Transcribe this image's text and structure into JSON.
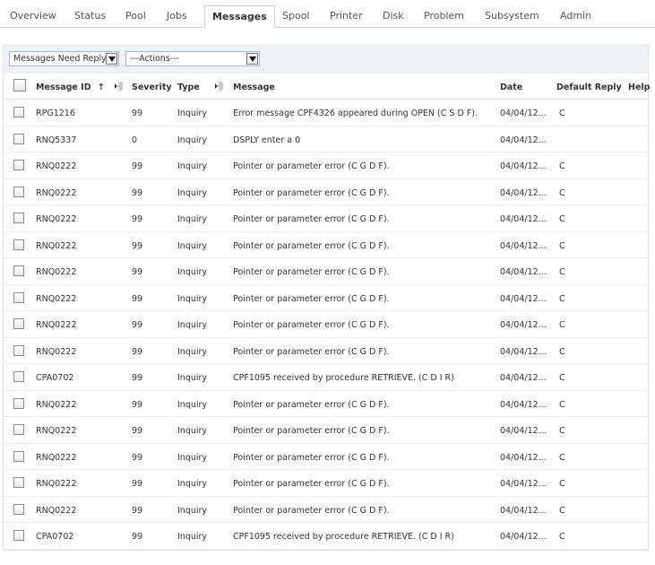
{
  "tabs": [
    {
      "label": "Overview",
      "active": false
    },
    {
      "label": "Status",
      "active": false
    },
    {
      "label": "Pool",
      "active": false
    },
    {
      "label": "Jobs",
      "active": false
    },
    {
      "label": "Messages",
      "active": true
    },
    {
      "label": "Spool",
      "active": false
    },
    {
      "label": "Printer",
      "active": false
    },
    {
      "label": "Disk",
      "active": false
    },
    {
      "label": "Problem",
      "active": false
    },
    {
      "label": "Subsystem",
      "active": false
    },
    {
      "label": "Admin",
      "active": false
    }
  ],
  "toolbar": {
    "filter_select": "Messages Need Reply",
    "actions_select": "---Actions---"
  },
  "columns": {
    "message_id": "Message ID",
    "sort_indicator": "↑",
    "severity": "Severity",
    "type": "Type",
    "message": "Message",
    "date": "Date",
    "default_reply": "Default Reply",
    "help": "Help"
  },
  "rows": [
    {
      "id": "RPG1216",
      "severity": "99",
      "type": "Inquiry",
      "message": "Error message CPF4326 appeared during OPEN (C S D F).",
      "date": "04/04/12...",
      "reply": "C"
    },
    {
      "id": "RNQ5337",
      "severity": "0",
      "type": "Inquiry",
      "message": "DSPLY enter a 0",
      "date": "04/04/12...",
      "reply": ""
    },
    {
      "id": "RNQ0222",
      "severity": "99",
      "type": "Inquiry",
      "message": "Pointer or parameter error (C G D F).",
      "date": "04/04/12...",
      "reply": "C"
    },
    {
      "id": "RNQ0222",
      "severity": "99",
      "type": "Inquiry",
      "message": "Pointer or parameter error (C G D F).",
      "date": "04/04/12...",
      "reply": "C"
    },
    {
      "id": "RNQ0222",
      "severity": "99",
      "type": "Inquiry",
      "message": "Pointer or parameter error (C G D F).",
      "date": "04/04/12...",
      "reply": "C"
    },
    {
      "id": "RNQ0222",
      "severity": "99",
      "type": "Inquiry",
      "message": "Pointer or parameter error (C G D F).",
      "date": "04/04/12...",
      "reply": "C"
    },
    {
      "id": "RNQ0222",
      "severity": "99",
      "type": "Inquiry",
      "message": "Pointer or parameter error (C G D F).",
      "date": "04/04/12...",
      "reply": "C"
    },
    {
      "id": "RNQ0222",
      "severity": "99",
      "type": "Inquiry",
      "message": "Pointer or parameter error (C G D F).",
      "date": "04/04/12...",
      "reply": "C"
    },
    {
      "id": "RNQ0222",
      "severity": "99",
      "type": "Inquiry",
      "message": "Pointer or parameter error (C G D F).",
      "date": "04/04/12...",
      "reply": "C"
    },
    {
      "id": "RNQ0222",
      "severity": "99",
      "type": "Inquiry",
      "message": "Pointer or parameter error (C G D F).",
      "date": "04/04/12...",
      "reply": "C"
    },
    {
      "id": "CPA0702",
      "severity": "99",
      "type": "Inquiry",
      "message": "CPF1095 received by procedure RETRIEVE. (C D I R)",
      "date": "04/04/12...",
      "reply": "C"
    },
    {
      "id": "RNQ0222",
      "severity": "99",
      "type": "Inquiry",
      "message": "Pointer or parameter error (C G D F).",
      "date": "04/04/12...",
      "reply": "C"
    },
    {
      "id": "RNQ0222",
      "severity": "99",
      "type": "Inquiry",
      "message": "Pointer or parameter error (C G D F).",
      "date": "04/04/12...",
      "reply": "C"
    },
    {
      "id": "RNQ0222",
      "severity": "99",
      "type": "Inquiry",
      "message": "Pointer or parameter error (C G D F).",
      "date": "04/04/12...",
      "reply": "C"
    },
    {
      "id": "RNQ0222",
      "severity": "99",
      "type": "Inquiry",
      "message": "Pointer or parameter error (C G D F).",
      "date": "04/04/12...",
      "reply": "C"
    },
    {
      "id": "RNQ0222",
      "severity": "99",
      "type": "Inquiry",
      "message": "Pointer or parameter error (C G D F).",
      "date": "04/04/12...",
      "reply": "C"
    },
    {
      "id": "CPA0702",
      "severity": "99",
      "type": "Inquiry",
      "message": "CPF1095 received by procedure RETRIEVE. (C D I R)",
      "date": "04/04/12...",
      "reply": "C"
    }
  ]
}
